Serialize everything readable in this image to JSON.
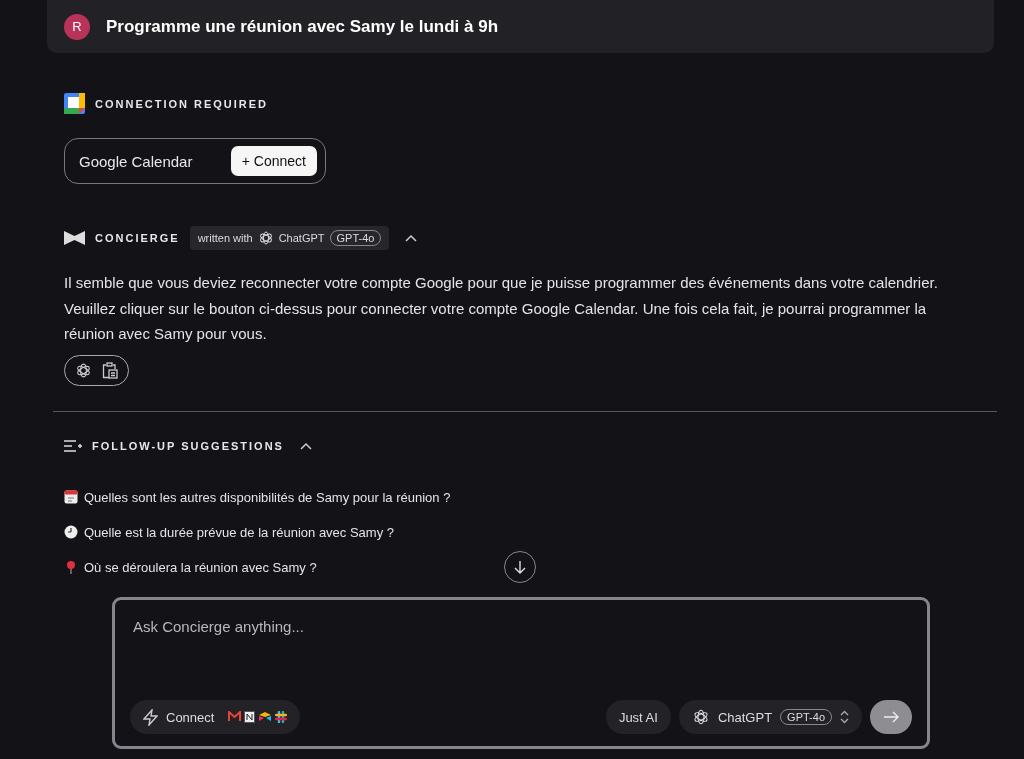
{
  "prompt": {
    "avatar": "R",
    "text": "Programme une réunion avec Samy le lundi à 9h"
  },
  "connection": {
    "heading": "CONNECTION REQUIRED",
    "service": "Google Calendar",
    "button": "+ Connect"
  },
  "response": {
    "agent": "CONCIERGE",
    "written_with": "written with",
    "model_name": "ChatGPT",
    "model_version": "GPT-4o",
    "expanded": true,
    "text": "Il semble que vous deviez reconnecter votre compte Google pour que je puisse programmer des événements dans votre calendrier. Veuillez cliquer sur le bouton ci-dessus pour connecter votre compte Google Calendar. Une fois cela fait, je pourrai programmer la réunion avec Samy pour vous."
  },
  "followups": {
    "heading": "FOLLOW-UP SUGGESTIONS",
    "expanded": true,
    "items": [
      {
        "kind": "calendar",
        "text": "Quelles sont les autres disponibilités de Samy pour la réunion ?"
      },
      {
        "kind": "clock",
        "text": "Quelle est la durée prévue de la réunion avec Samy ?"
      },
      {
        "kind": "pin",
        "text": "Où se déroulera la réunion avec Samy ?"
      }
    ]
  },
  "composer": {
    "placeholder": "Ask Concierge anything...",
    "connect": "Connect",
    "mode": "Just AI",
    "model_name": "ChatGPT",
    "model_version": "GPT-4o"
  }
}
